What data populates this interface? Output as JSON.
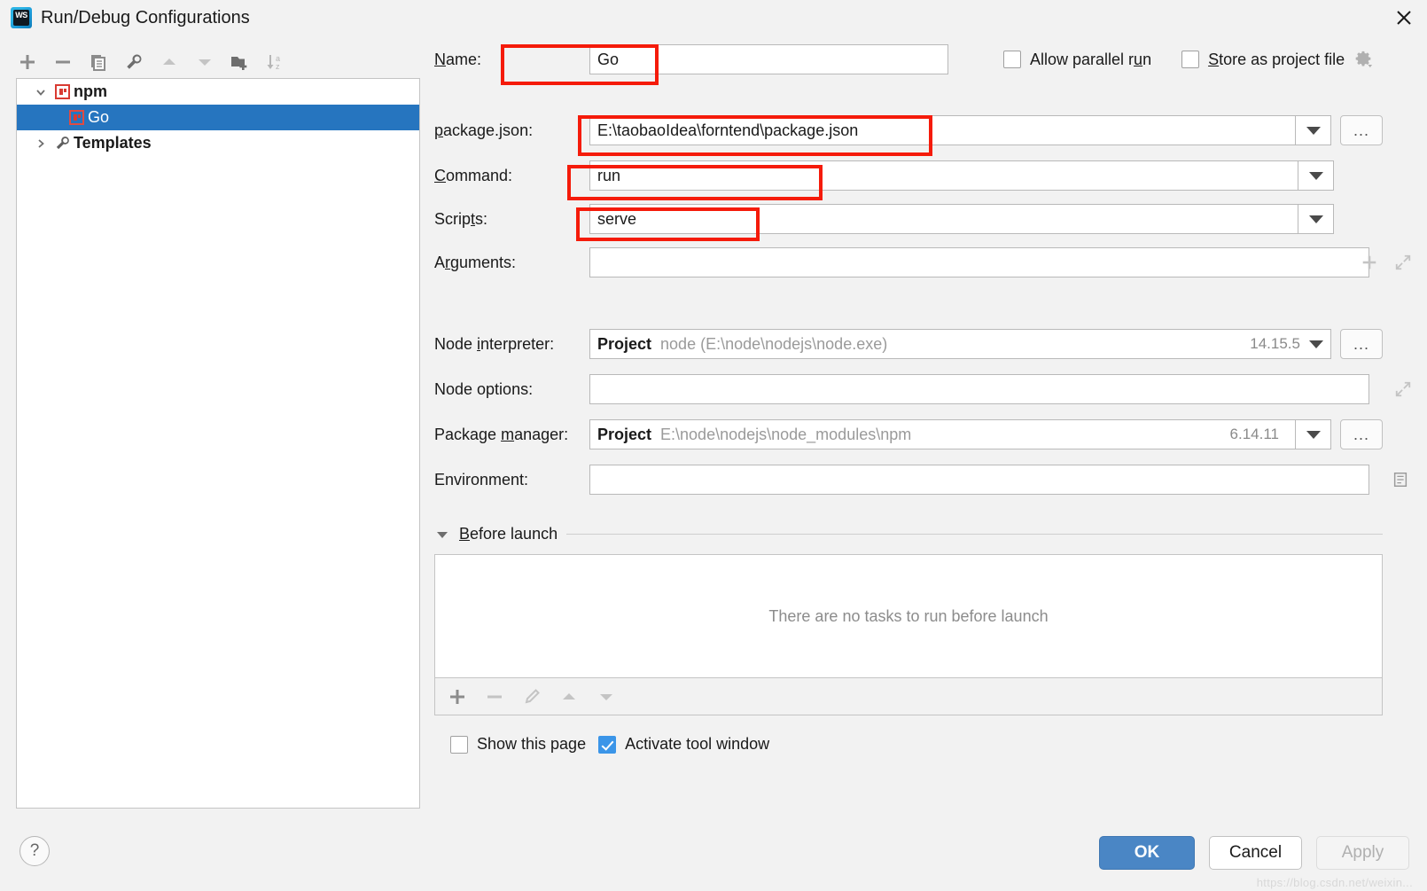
{
  "window": {
    "title": "Run/Debug Configurations",
    "logo_icon": "webstorm-logo-icon",
    "close_icon": "close-icon"
  },
  "left_panel": {
    "toolbar": [
      {
        "name": "add",
        "icon": "plus-icon",
        "enabled": true
      },
      {
        "name": "remove",
        "icon": "minus-icon",
        "enabled": true
      },
      {
        "name": "copy",
        "icon": "copy-icon",
        "enabled": true
      },
      {
        "name": "edit-templates",
        "icon": "wrench-icon",
        "enabled": true
      },
      {
        "name": "move-up",
        "icon": "arrow-up-icon",
        "enabled": false
      },
      {
        "name": "move-down",
        "icon": "arrow-down-icon",
        "enabled": false
      },
      {
        "name": "new-folder",
        "icon": "new-folder-icon",
        "enabled": true
      },
      {
        "name": "sort-alphabetically",
        "icon": "sort-az-icon",
        "enabled": false
      }
    ],
    "tree": [
      {
        "label": "npm",
        "icon": "npm-icon",
        "expanded": true,
        "level": 0,
        "selected": false
      },
      {
        "label": "Go",
        "icon": "npm-icon",
        "level": 1,
        "selected": true
      },
      {
        "label": "Templates",
        "icon": "wrench-icon",
        "expanded": false,
        "level": 0,
        "selected": false
      }
    ]
  },
  "form": {
    "name": {
      "label": "Name:",
      "label_mnemonic": "N",
      "value": "Go",
      "highlighted": true
    },
    "allow_parallel_run": {
      "label": "Allow parallel run",
      "label_mnemonic": "u",
      "checked": false
    },
    "store_as_project_file": {
      "label": "Store as project file",
      "label_mnemonic": "S",
      "checked": false,
      "icon": "gear-icon"
    },
    "package_json": {
      "label": "package.json:",
      "label_mnemonic": "p",
      "value": "E:\\taobaoIdea\\forntend\\package.json",
      "highlighted": true,
      "dropdown_icon": "chevron-down-icon",
      "browse_label": "...",
      "browse_icon": "browse-icon"
    },
    "command": {
      "label": "Command:",
      "label_mnemonic": "C",
      "value": "run",
      "highlighted": true,
      "dropdown_icon": "chevron-down-icon"
    },
    "scripts": {
      "label": "Scripts:",
      "label_mnemonic": "t",
      "value": "serve",
      "highlighted": true,
      "dropdown_icon": "chevron-down-icon"
    },
    "arguments": {
      "label": "Arguments:",
      "label_mnemonic": "r",
      "value": "",
      "placeholder": "",
      "add_icon": "plus-icon",
      "expand_icon": "expand-icon"
    },
    "node_interpreter": {
      "label": "Node interpreter:",
      "label_mnemonic": "i",
      "scope": "Project",
      "value": "node (E:\\node\\nodejs\\node.exe)",
      "version": "14.15.5",
      "dropdown_icon": "chevron-down-icon",
      "browse_label": "...",
      "browse_icon": "browse-icon"
    },
    "node_options": {
      "label": "Node options:",
      "value": "",
      "placeholder": "",
      "expand_icon": "expand-icon"
    },
    "package_manager": {
      "label": "Package manager:",
      "label_mnemonic": "m",
      "scope": "Project",
      "value": "E:\\node\\nodejs\\node_modules\\npm",
      "version": "6.14.11",
      "dropdown_icon": "chevron-down-icon",
      "browse_label": "...",
      "browse_icon": "browse-icon"
    },
    "environment": {
      "label": "Environment:",
      "value": "",
      "placeholder": "",
      "edit_icon": "env-vars-icon"
    }
  },
  "before_launch": {
    "title": "Before launch",
    "title_mnemonic": "B",
    "collapse_icon": "triangle-down-icon",
    "expanded": true,
    "empty_text": "There are no tasks to run before launch",
    "tasks": [],
    "toolbar": [
      {
        "name": "add-task",
        "icon": "plus-icon",
        "enabled": true
      },
      {
        "name": "remove-task",
        "icon": "minus-icon",
        "enabled": false
      },
      {
        "name": "edit-task",
        "icon": "pencil-icon",
        "enabled": false
      },
      {
        "name": "move-task-up",
        "icon": "arrow-up-icon",
        "enabled": false
      },
      {
        "name": "move-task-down",
        "icon": "arrow-down-icon",
        "enabled": false
      }
    ],
    "show_this_page": {
      "label": "Show this page",
      "checked": false
    },
    "activate_tool_window": {
      "label": "Activate tool window",
      "checked": true
    }
  },
  "footer": {
    "help_label": "?",
    "help_icon": "help-icon",
    "ok_label": "OK",
    "cancel_label": "Cancel",
    "apply_label": "Apply",
    "apply_enabled": false
  },
  "colors": {
    "accent": "#4a86c5",
    "selection": "#2675bf",
    "annotation": "#f51b0a",
    "checked": "#3b95e8",
    "npm_red": "#d93b32"
  },
  "watermark": "https://blog.csdn.net/weixin..."
}
